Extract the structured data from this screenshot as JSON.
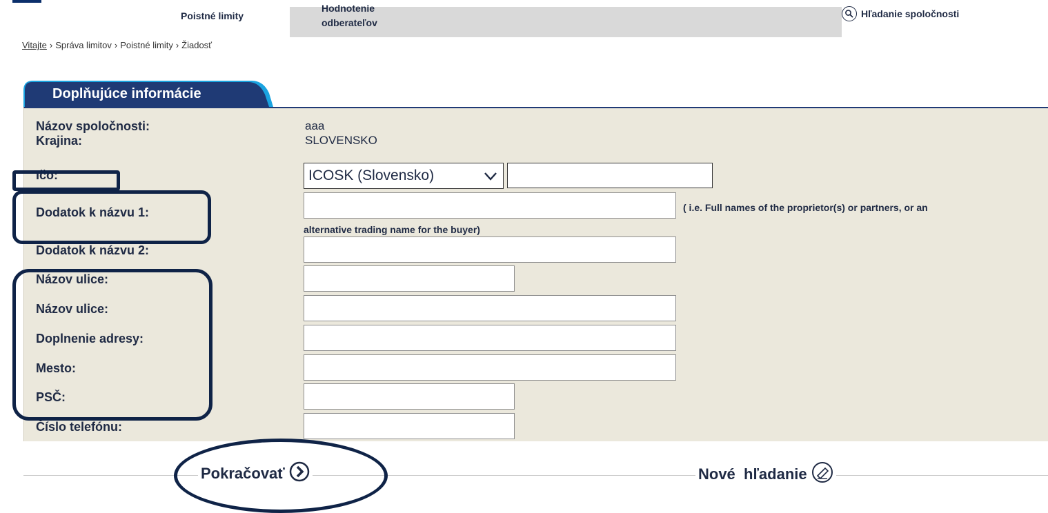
{
  "nav": {
    "limits_label": "Poistné limity",
    "rating_label": "Hodnotenie odberateľov",
    "company_search_label": "Hľadanie spoločnosti"
  },
  "breadcrumb": [
    "Vitajte",
    "Správa limitov",
    "Poistné limity",
    "Žiadosť"
  ],
  "section_tab": "Doplňujúce informácie",
  "form": {
    "company_name_label": "Názov spoločnosti:",
    "company_name_value": "aaa",
    "country_label": "Krajina:",
    "country_value": "SLOVENSKO",
    "ico_label": "Ičo:",
    "ico_type_selected": "ICOSK (Slovensko)",
    "ico_value": "",
    "name_addition_1_label": "Dodatok k názvu 1:",
    "name_addition_1_value": "",
    "name_addition_1_hint_a": "( i.e. Full names of the proprietor(s) or partners, or an",
    "name_addition_1_hint_b": "alternative trading name for the buyer)",
    "name_addition_2_label": "Dodatok k názvu 2:",
    "name_addition_2_value": "",
    "street_1_label": "Názov ulice:",
    "street_1_value": "",
    "street_2_label": "Názov ulice:",
    "street_2_value": "",
    "address_addition_label": "Doplnenie adresy:",
    "address_addition_value": "",
    "city_label": "Mesto:",
    "city_value": "",
    "zip_label": "PSČ:",
    "zip_value": "",
    "phone_label": "Číslo telefónu:",
    "phone_value": ""
  },
  "actions": {
    "continue_label": "Pokračovať",
    "new_search_label": "Nové  hľadanie"
  },
  "colors": {
    "panel_bg": "#ebe8dc",
    "tab_bg": "#1f3a75",
    "tab_accent": "#1aa3e0",
    "text": "#1f2a44",
    "annotation": "#0f2347"
  }
}
